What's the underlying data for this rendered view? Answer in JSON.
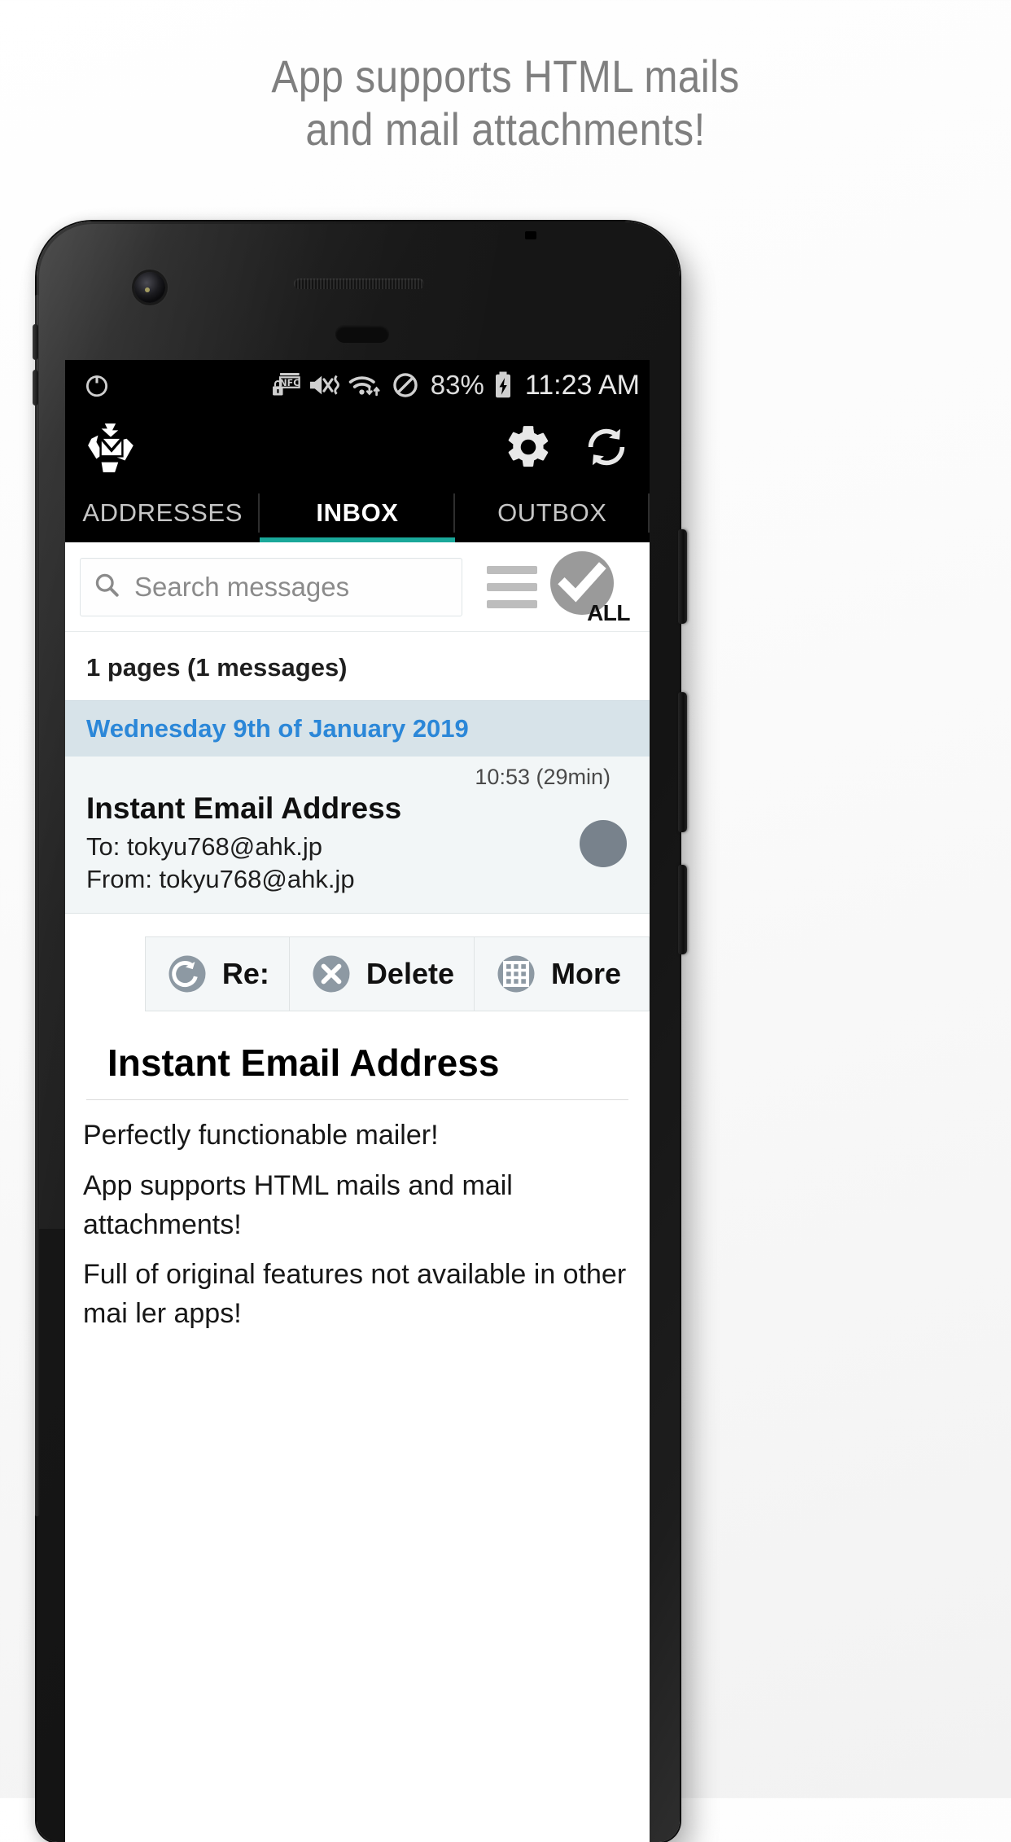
{
  "promo": {
    "headline": "App supports HTML mails\nand mail attachments!",
    "headline_color": "#7f7f7f",
    "background_color": "#f7f7f7"
  },
  "statusbar": {
    "icons": [
      "nfc-lock-icon",
      "volume-mute-vibrate-icon",
      "wifi-transfer-icon",
      "do-not-disturb-icon"
    ],
    "battery_percent": "83%",
    "battery_state_icon": "battery-charging-icon",
    "clock": "11:23 AM",
    "power_icon": "power-saver-icon",
    "background_color": "#000000",
    "text_color": "#dcdcdc"
  },
  "appbar": {
    "logo_icon": "recycle-envelope-logo",
    "settings_icon": "gear-icon",
    "refresh_icon": "sync-refresh-icon",
    "background_color": "#000000"
  },
  "tabs": {
    "accent_color": "#1aa89a",
    "items": [
      {
        "label": "ADDRESSES",
        "active": false
      },
      {
        "label": "INBOX",
        "active": true
      },
      {
        "label": "OUTBOX",
        "active": false
      }
    ]
  },
  "search": {
    "placeholder": "Search messages",
    "value": "",
    "search_icon": "search-icon",
    "menu_icon": "hamburger-menu-icon",
    "select_all": {
      "label": "ALL",
      "icon": "checkmark-circle-icon",
      "circle_color": "#9a9a9a"
    }
  },
  "list": {
    "pages_summary": "1 pages (1 messages)",
    "date_header": {
      "label": "Wednesday 9th of January 2019",
      "text_color": "#2b87d8",
      "background_color": "#d7e3e9"
    },
    "messages": [
      {
        "time": "10:53 (29min)",
        "subject": "Instant Email Address",
        "to": "To: tokyu768@ahk.jp",
        "from": "From: tokyu768@ahk.jp",
        "avatar_color": "#78828c"
      }
    ]
  },
  "actions": [
    {
      "label": "Re:",
      "icon": "reply-icon"
    },
    {
      "label": "Delete",
      "icon": "delete-circle-icon"
    },
    {
      "label": "More",
      "icon": "grid-more-icon"
    }
  ],
  "message_body": {
    "title": "Instant Email Address",
    "paragraphs": [
      "Perfectly functionable mailer!",
      "App supports HTML mails and mail attachments!",
      "Full of original features not available in other mai ler apps!"
    ]
  }
}
